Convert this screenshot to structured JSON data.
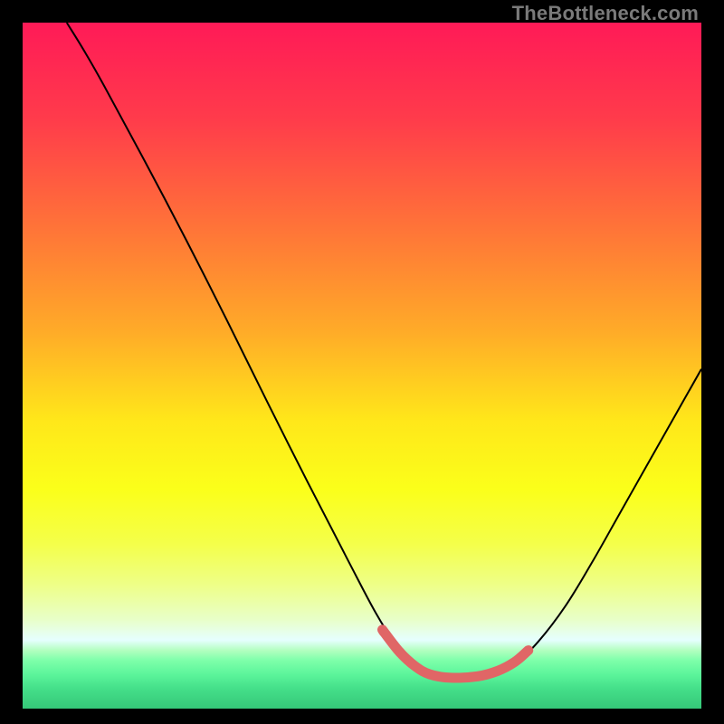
{
  "watermark": "TheBottleneck.com",
  "chart_data": {
    "type": "line",
    "title": "",
    "xlabel": "",
    "ylabel": "",
    "xlim": [
      0,
      100
    ],
    "ylim": [
      0,
      100
    ],
    "grid": false,
    "legend": false,
    "gradient_stops": [
      {
        "offset": 0,
        "color": "#ff1a57"
      },
      {
        "offset": 14,
        "color": "#ff3b4b"
      },
      {
        "offset": 30,
        "color": "#ff7438"
      },
      {
        "offset": 45,
        "color": "#ffab28"
      },
      {
        "offset": 58,
        "color": "#ffe71a"
      },
      {
        "offset": 68,
        "color": "#fbff1a"
      },
      {
        "offset": 76,
        "color": "#f4ff4a"
      },
      {
        "offset": 82,
        "color": "#eeff88"
      },
      {
        "offset": 87,
        "color": "#e8ffc8"
      },
      {
        "offset": 90,
        "color": "#e6ffff"
      },
      {
        "offset": 91.5,
        "color": "#b3ffc0"
      },
      {
        "offset": 93,
        "color": "#7dffaa"
      },
      {
        "offset": 95,
        "color": "#5cf59b"
      },
      {
        "offset": 97,
        "color": "#45e08a"
      },
      {
        "offset": 100,
        "color": "#35c778"
      }
    ],
    "series": [
      {
        "name": "bottleneck-curve",
        "color": "#000000",
        "width": 2,
        "points": [
          {
            "x": 6.5,
            "y": 100.0
          },
          {
            "x": 9.0,
            "y": 96.0
          },
          {
            "x": 12.0,
            "y": 90.8
          },
          {
            "x": 18.0,
            "y": 79.8
          },
          {
            "x": 24.0,
            "y": 68.5
          },
          {
            "x": 30.0,
            "y": 56.8
          },
          {
            "x": 36.0,
            "y": 44.8
          },
          {
            "x": 42.0,
            "y": 33.0
          },
          {
            "x": 48.0,
            "y": 21.5
          },
          {
            "x": 52.0,
            "y": 14.0
          },
          {
            "x": 55.0,
            "y": 9.3
          },
          {
            "x": 57.5,
            "y": 6.5
          },
          {
            "x": 60.0,
            "y": 5.0
          },
          {
            "x": 63.0,
            "y": 4.5
          },
          {
            "x": 67.0,
            "y": 4.7
          },
          {
            "x": 70.0,
            "y": 5.5
          },
          {
            "x": 73.0,
            "y": 7.0
          },
          {
            "x": 76.0,
            "y": 9.8
          },
          {
            "x": 80.0,
            "y": 15.0
          },
          {
            "x": 84.0,
            "y": 21.5
          },
          {
            "x": 88.0,
            "y": 28.5
          },
          {
            "x": 92.0,
            "y": 35.5
          },
          {
            "x": 96.0,
            "y": 42.5
          },
          {
            "x": 100.0,
            "y": 49.5
          }
        ]
      },
      {
        "name": "highlight-band",
        "color": "#e06666",
        "width": 11,
        "linecap": "round",
        "points": [
          {
            "x": 53.0,
            "y": 11.5
          },
          {
            "x": 55.5,
            "y": 8.3
          },
          {
            "x": 57.8,
            "y": 6.2
          },
          {
            "x": 60.0,
            "y": 5.0
          },
          {
            "x": 63.0,
            "y": 4.5
          },
          {
            "x": 67.0,
            "y": 4.7
          },
          {
            "x": 70.0,
            "y": 5.5
          },
          {
            "x": 72.5,
            "y": 6.8
          },
          {
            "x": 74.5,
            "y": 8.5
          }
        ]
      },
      {
        "name": "highlight-dot-a",
        "type": "dot",
        "color": "#e06666",
        "r": 5.5,
        "cx": 53.2,
        "cy": 11.2
      },
      {
        "name": "highlight-dot-b",
        "type": "dot",
        "color": "#e06666",
        "r": 5.5,
        "cx": 55.6,
        "cy": 8.2
      }
    ]
  }
}
